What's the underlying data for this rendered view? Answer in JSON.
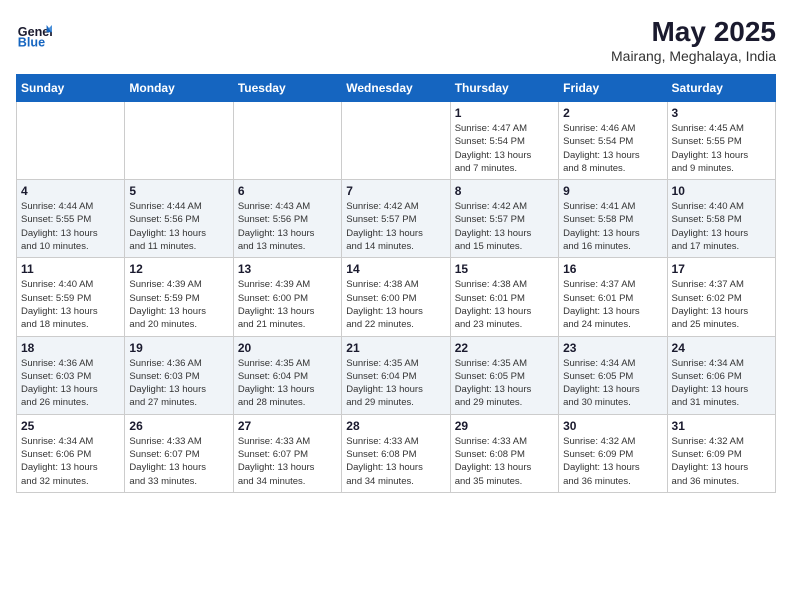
{
  "header": {
    "logo_line1": "General",
    "logo_line2": "Blue",
    "month_year": "May 2025",
    "location": "Mairang, Meghalaya, India"
  },
  "days_of_week": [
    "Sunday",
    "Monday",
    "Tuesday",
    "Wednesday",
    "Thursday",
    "Friday",
    "Saturday"
  ],
  "weeks": [
    [
      {
        "day": "",
        "info": ""
      },
      {
        "day": "",
        "info": ""
      },
      {
        "day": "",
        "info": ""
      },
      {
        "day": "",
        "info": ""
      },
      {
        "day": "1",
        "info": "Sunrise: 4:47 AM\nSunset: 5:54 PM\nDaylight: 13 hours\nand 7 minutes."
      },
      {
        "day": "2",
        "info": "Sunrise: 4:46 AM\nSunset: 5:54 PM\nDaylight: 13 hours\nand 8 minutes."
      },
      {
        "day": "3",
        "info": "Sunrise: 4:45 AM\nSunset: 5:55 PM\nDaylight: 13 hours\nand 9 minutes."
      }
    ],
    [
      {
        "day": "4",
        "info": "Sunrise: 4:44 AM\nSunset: 5:55 PM\nDaylight: 13 hours\nand 10 minutes."
      },
      {
        "day": "5",
        "info": "Sunrise: 4:44 AM\nSunset: 5:56 PM\nDaylight: 13 hours\nand 11 minutes."
      },
      {
        "day": "6",
        "info": "Sunrise: 4:43 AM\nSunset: 5:56 PM\nDaylight: 13 hours\nand 13 minutes."
      },
      {
        "day": "7",
        "info": "Sunrise: 4:42 AM\nSunset: 5:57 PM\nDaylight: 13 hours\nand 14 minutes."
      },
      {
        "day": "8",
        "info": "Sunrise: 4:42 AM\nSunset: 5:57 PM\nDaylight: 13 hours\nand 15 minutes."
      },
      {
        "day": "9",
        "info": "Sunrise: 4:41 AM\nSunset: 5:58 PM\nDaylight: 13 hours\nand 16 minutes."
      },
      {
        "day": "10",
        "info": "Sunrise: 4:40 AM\nSunset: 5:58 PM\nDaylight: 13 hours\nand 17 minutes."
      }
    ],
    [
      {
        "day": "11",
        "info": "Sunrise: 4:40 AM\nSunset: 5:59 PM\nDaylight: 13 hours\nand 18 minutes."
      },
      {
        "day": "12",
        "info": "Sunrise: 4:39 AM\nSunset: 5:59 PM\nDaylight: 13 hours\nand 20 minutes."
      },
      {
        "day": "13",
        "info": "Sunrise: 4:39 AM\nSunset: 6:00 PM\nDaylight: 13 hours\nand 21 minutes."
      },
      {
        "day": "14",
        "info": "Sunrise: 4:38 AM\nSunset: 6:00 PM\nDaylight: 13 hours\nand 22 minutes."
      },
      {
        "day": "15",
        "info": "Sunrise: 4:38 AM\nSunset: 6:01 PM\nDaylight: 13 hours\nand 23 minutes."
      },
      {
        "day": "16",
        "info": "Sunrise: 4:37 AM\nSunset: 6:01 PM\nDaylight: 13 hours\nand 24 minutes."
      },
      {
        "day": "17",
        "info": "Sunrise: 4:37 AM\nSunset: 6:02 PM\nDaylight: 13 hours\nand 25 minutes."
      }
    ],
    [
      {
        "day": "18",
        "info": "Sunrise: 4:36 AM\nSunset: 6:03 PM\nDaylight: 13 hours\nand 26 minutes."
      },
      {
        "day": "19",
        "info": "Sunrise: 4:36 AM\nSunset: 6:03 PM\nDaylight: 13 hours\nand 27 minutes."
      },
      {
        "day": "20",
        "info": "Sunrise: 4:35 AM\nSunset: 6:04 PM\nDaylight: 13 hours\nand 28 minutes."
      },
      {
        "day": "21",
        "info": "Sunrise: 4:35 AM\nSunset: 6:04 PM\nDaylight: 13 hours\nand 29 minutes."
      },
      {
        "day": "22",
        "info": "Sunrise: 4:35 AM\nSunset: 6:05 PM\nDaylight: 13 hours\nand 29 minutes."
      },
      {
        "day": "23",
        "info": "Sunrise: 4:34 AM\nSunset: 6:05 PM\nDaylight: 13 hours\nand 30 minutes."
      },
      {
        "day": "24",
        "info": "Sunrise: 4:34 AM\nSunset: 6:06 PM\nDaylight: 13 hours\nand 31 minutes."
      }
    ],
    [
      {
        "day": "25",
        "info": "Sunrise: 4:34 AM\nSunset: 6:06 PM\nDaylight: 13 hours\nand 32 minutes."
      },
      {
        "day": "26",
        "info": "Sunrise: 4:33 AM\nSunset: 6:07 PM\nDaylight: 13 hours\nand 33 minutes."
      },
      {
        "day": "27",
        "info": "Sunrise: 4:33 AM\nSunset: 6:07 PM\nDaylight: 13 hours\nand 34 minutes."
      },
      {
        "day": "28",
        "info": "Sunrise: 4:33 AM\nSunset: 6:08 PM\nDaylight: 13 hours\nand 34 minutes."
      },
      {
        "day": "29",
        "info": "Sunrise: 4:33 AM\nSunset: 6:08 PM\nDaylight: 13 hours\nand 35 minutes."
      },
      {
        "day": "30",
        "info": "Sunrise: 4:32 AM\nSunset: 6:09 PM\nDaylight: 13 hours\nand 36 minutes."
      },
      {
        "day": "31",
        "info": "Sunrise: 4:32 AM\nSunset: 6:09 PM\nDaylight: 13 hours\nand 36 minutes."
      }
    ]
  ]
}
